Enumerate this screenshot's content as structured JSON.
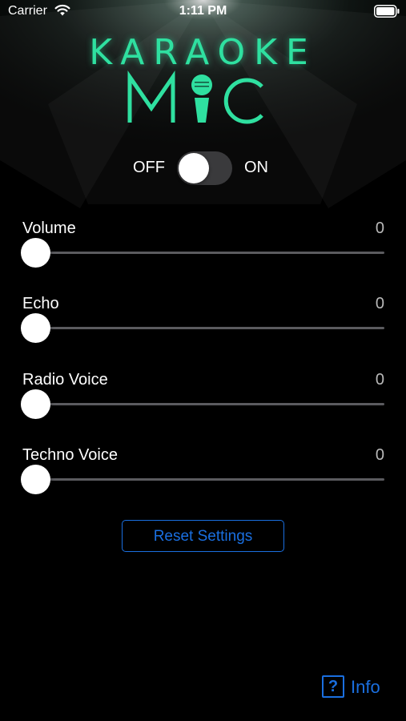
{
  "status_bar": {
    "carrier": "Carrier",
    "time": "1:11 PM",
    "icons": [
      "wifi-icon",
      "battery-icon"
    ]
  },
  "logo": {
    "line1": "KARAOKE",
    "line2": "MIC",
    "color": "#2fe0a0"
  },
  "power_toggle": {
    "off_label": "OFF",
    "on_label": "ON",
    "state": "off"
  },
  "sliders": [
    {
      "label": "Volume",
      "value": "0"
    },
    {
      "label": "Echo",
      "value": "0"
    },
    {
      "label": "Radio Voice",
      "value": "0"
    },
    {
      "label": "Techno Voice",
      "value": "0"
    }
  ],
  "reset_button": {
    "label": "Reset Settings"
  },
  "info": {
    "icon": "question-mark-icon",
    "label": "Info"
  },
  "colors": {
    "accent": "#1a6fe0",
    "logo": "#2fe0a0",
    "background": "#000000"
  }
}
